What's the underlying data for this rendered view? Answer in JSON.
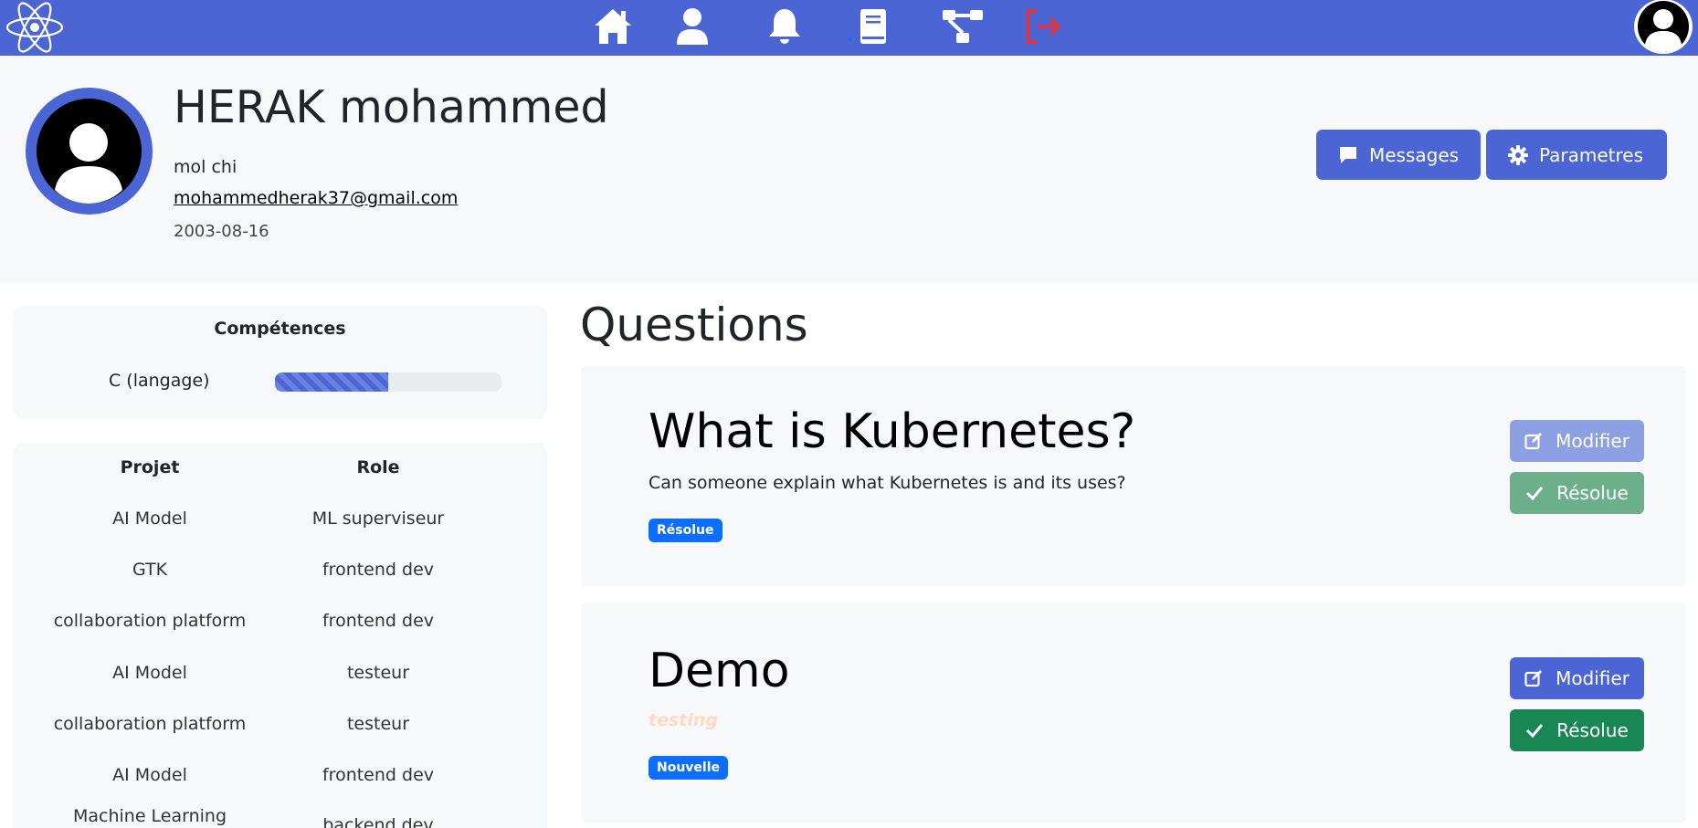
{
  "nav": {
    "icons": [
      "atom-logo-icon",
      "home-icon",
      "user-icon",
      "bell-icon",
      "book-icon",
      "sitemap-icon",
      "logout-icon",
      "avatar-icon"
    ],
    "colors": {
      "bar": "#4b66d4",
      "logout": "#dc3545"
    }
  },
  "profile": {
    "name": "HERAK mohammed",
    "subtitle": "mol chi",
    "email": "mohammedherak37@gmail.com",
    "birthdate": "2003-08-16",
    "messages_label": "Messages",
    "settings_label": "Parametres"
  },
  "skills": {
    "title": "Compétences",
    "items": [
      {
        "name": "C (langage)",
        "progress_pct": 50
      }
    ]
  },
  "projects": {
    "headers": {
      "project": "Projet",
      "role": "Role"
    },
    "rows": [
      {
        "project": "AI Model",
        "role": "ML superviseur"
      },
      {
        "project": "GTK",
        "role": "frontend dev"
      },
      {
        "project": "collaboration platform",
        "role": "frontend dev"
      },
      {
        "project": "AI Model",
        "role": "testeur"
      },
      {
        "project": "collaboration platform",
        "role": "testeur"
      },
      {
        "project": "AI Model",
        "role": "frontend dev"
      },
      {
        "project": "Machine Learning",
        "role": "backend dev"
      }
    ]
  },
  "questions": {
    "heading": "Questions",
    "items": [
      {
        "title": "What is Kubernetes?",
        "body": "Can someone explain what Kubernetes is and its uses?",
        "status": "Résolue",
        "modify_label": "Modifier",
        "resolve_label": "Résolue"
      },
      {
        "title": "Demo",
        "body": "testing",
        "status": "Nouvelle",
        "modify_label": "Modifier",
        "resolve_label": "Résolue"
      }
    ]
  }
}
